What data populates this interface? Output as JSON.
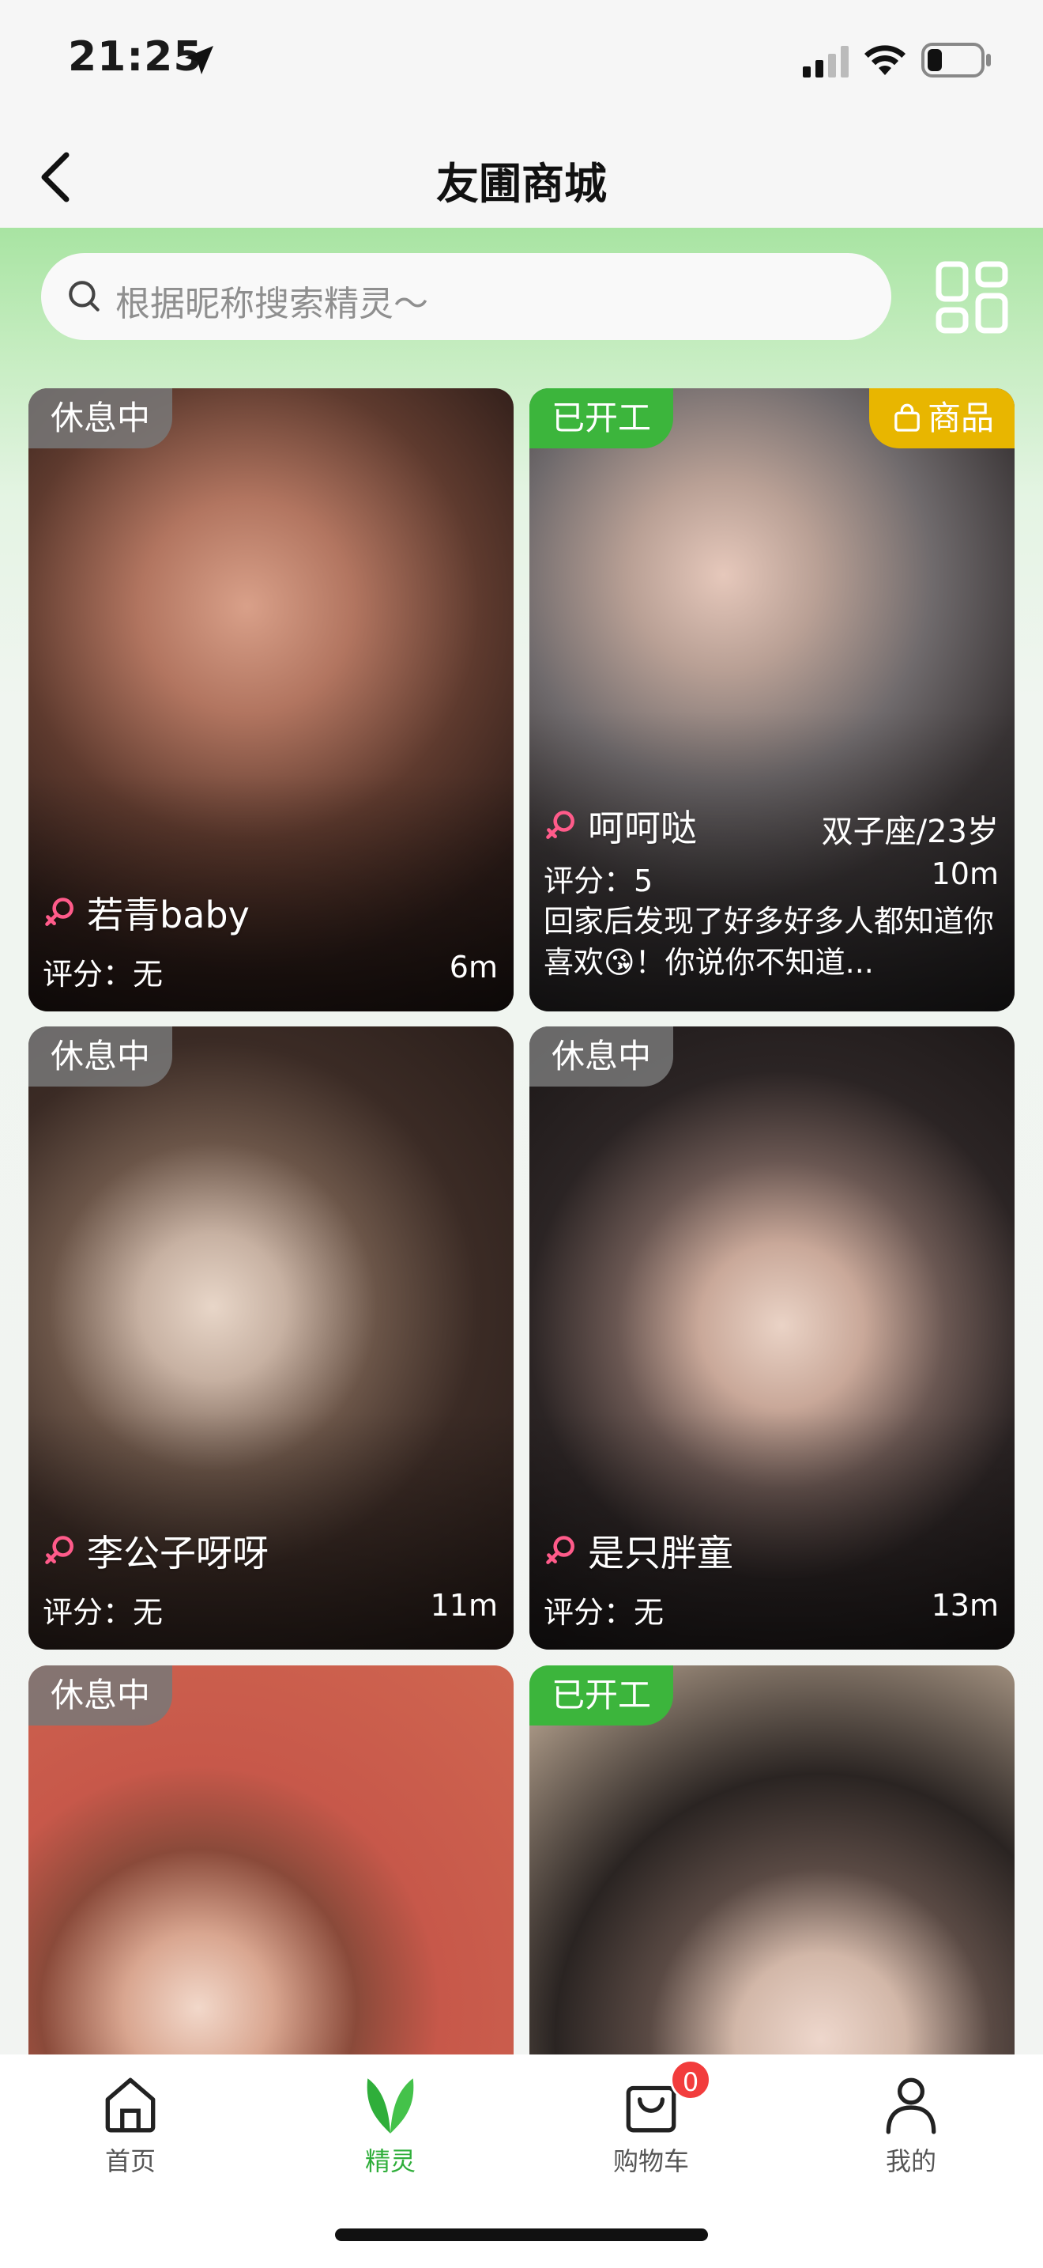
{
  "status_bar": {
    "time": "21:25"
  },
  "nav": {
    "title": "友圃商城"
  },
  "search": {
    "placeholder": "根据昵称搜索精灵～"
  },
  "cards": [
    {
      "status": "休息中",
      "name": "若青baby",
      "rating_label": "评分：无",
      "distance": "6m"
    },
    {
      "status": "已开工",
      "goods_label": "商品",
      "name": "呵呵哒",
      "zodiac_age": "双子座/23岁",
      "rating_label": "评分：5",
      "distance": "10m",
      "bio": "回家后发现了好多好多人都知道你喜欢😘！你说你不知道..."
    },
    {
      "status": "休息中",
      "name": "李公子呀呀",
      "rating_label": "评分：无",
      "distance": "11m"
    },
    {
      "status": "休息中",
      "name": "是只胖童",
      "rating_label": "评分：无",
      "distance": "13m"
    },
    {
      "status": "休息中"
    },
    {
      "status": "已开工"
    }
  ],
  "tabs": [
    {
      "label": "首页",
      "icon": "home-icon"
    },
    {
      "label": "精灵",
      "icon": "sprite-leaf-icon",
      "active": true
    },
    {
      "label": "购物车",
      "icon": "cart-icon",
      "badge": "0"
    },
    {
      "label": "我的",
      "icon": "profile-icon"
    }
  ],
  "colors": {
    "accent": "#2fae3a",
    "work_tag": "#3cb53c",
    "goods_tag": "#e8b600",
    "badge": "#f23c3c"
  }
}
